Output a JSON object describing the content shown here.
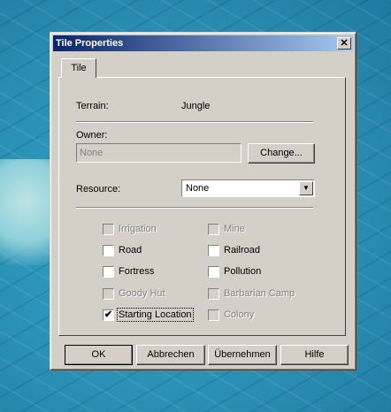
{
  "dialog": {
    "title": "Tile Properties",
    "close_glyph": "✕",
    "tabs": [
      {
        "label": "Tile"
      }
    ],
    "terrain": {
      "label": "Terrain:",
      "value": "Jungle"
    },
    "owner": {
      "label": "Owner:",
      "value": "None",
      "change_button": "Change..."
    },
    "resource": {
      "label": "Resource:",
      "selected": "None",
      "arrow_glyph": "▼"
    },
    "checkboxes": [
      {
        "label": "Irrigation",
        "checked": false,
        "enabled": false
      },
      {
        "label": "Mine",
        "checked": false,
        "enabled": false
      },
      {
        "label": "Road",
        "checked": false,
        "enabled": true
      },
      {
        "label": "Railroad",
        "checked": false,
        "enabled": true
      },
      {
        "label": "Fortress",
        "checked": false,
        "enabled": true
      },
      {
        "label": "Pollution",
        "checked": false,
        "enabled": true
      },
      {
        "label": "Goody Hut",
        "checked": false,
        "enabled": false
      },
      {
        "label": "Barbarian Camp",
        "checked": false,
        "enabled": false
      },
      {
        "label": "Starting Location",
        "checked": true,
        "enabled": true
      },
      {
        "label": "Colony",
        "checked": false,
        "enabled": false
      }
    ],
    "check_glyph": "✔",
    "buttons": {
      "ok": "OK",
      "cancel": "Abbrechen",
      "apply": "Übernehmen",
      "help": "Hilfe"
    }
  }
}
